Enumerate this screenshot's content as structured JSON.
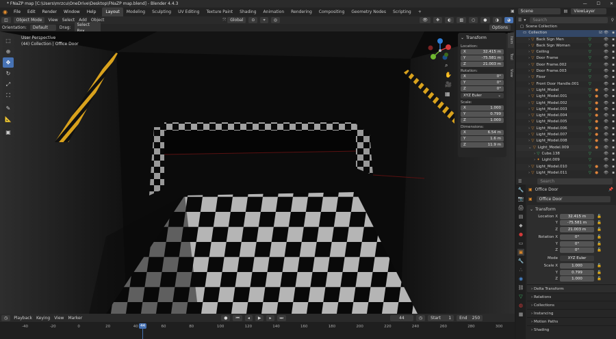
{
  "window": {
    "title": "* FNaZP map [C:\\Users\\mrzcu\\OneDrive\\Desktop\\FNaZP map.blend] - Blender 4.4.3"
  },
  "menu": [
    "File",
    "Edit",
    "Render",
    "Window",
    "Help"
  ],
  "workspaces": [
    "Layout",
    "Modeling",
    "Sculpting",
    "UV Editing",
    "Texture Paint",
    "Shading",
    "Animation",
    "Rendering",
    "Compositing",
    "Geometry Nodes",
    "Scripting"
  ],
  "scene": {
    "name": "Scene",
    "view_layer": "ViewLayer"
  },
  "viewport_header": {
    "mode": "Object Mode",
    "menus": [
      "View",
      "Select",
      "Add",
      "Object"
    ],
    "transform_orientation": "Global",
    "orientation_label": "Orientation:",
    "orientation_value": "Default",
    "drag_label": "Drag:",
    "drag_value": "Select Box",
    "options": "Options"
  },
  "viewport_overlay": {
    "perspective": "User Perspective",
    "collection_info": "(44) Collection | Office Door"
  },
  "gizmo": {
    "x": "X",
    "y": "Y",
    "z": "Z"
  },
  "npanel": {
    "tabs": [
      "Item",
      "Tool",
      "View"
    ],
    "header": "Transform",
    "location_label": "Location:",
    "location": [
      {
        "axis": "X",
        "value": "32.415 m"
      },
      {
        "axis": "Y",
        "value": "-75.581 m"
      },
      {
        "axis": "Z",
        "value": "21.003 m"
      }
    ],
    "rotation_label": "Rotation:",
    "rotation": [
      {
        "axis": "X",
        "value": "0°"
      },
      {
        "axis": "Y",
        "value": "0°"
      },
      {
        "axis": "Z",
        "value": "0°"
      }
    ],
    "rotation_mode": "XYZ Euler",
    "scale_label": "Scale:",
    "scale": [
      {
        "axis": "X",
        "value": "1.000"
      },
      {
        "axis": "Y",
        "value": "0.799"
      },
      {
        "axis": "Z",
        "value": "1.000"
      }
    ],
    "dimensions_label": "Dimensions:",
    "dimensions": [
      {
        "axis": "X",
        "value": "6.54 m"
      },
      {
        "axis": "Y",
        "value": "1.6 m"
      },
      {
        "axis": "Z",
        "value": "11.9 m"
      }
    ]
  },
  "outliner": {
    "search_placeholder": "Search",
    "root": "Scene Collection",
    "collection": "Collection",
    "items": [
      {
        "name": "Back Sign Men"
      },
      {
        "name": "Back Sign Woman"
      },
      {
        "name": "Ceiling"
      },
      {
        "name": "Door Frame"
      },
      {
        "name": "Door Frame.002"
      },
      {
        "name": "Door Frame.003"
      },
      {
        "name": "Floor"
      },
      {
        "name": "Front Door Handle.001"
      },
      {
        "name": "Light_Model"
      },
      {
        "name": "Light_Model.001"
      },
      {
        "name": "Light_Model.002"
      },
      {
        "name": "Light_Model.003"
      },
      {
        "name": "Light_Model.004"
      },
      {
        "name": "Light_Model.005"
      },
      {
        "name": "Light_Model.006"
      },
      {
        "name": "Light_Model.007"
      },
      {
        "name": "Light_Model.008"
      },
      {
        "name": "Light_Model.009"
      },
      {
        "name": "Cube.138"
      },
      {
        "name": "Light.009"
      },
      {
        "name": "Light_Model.010"
      },
      {
        "name": "Light_Model.011"
      }
    ]
  },
  "properties": {
    "search_placeholder": "Search",
    "object_name": "Office Door",
    "object_field": "Office Door",
    "transform_header": "Transform",
    "location": [
      {
        "label": "Location X",
        "value": "32.415 m"
      },
      {
        "label": "Y",
        "value": "-75.581 m"
      },
      {
        "label": "Z",
        "value": "21.003 m"
      }
    ],
    "rotation": [
      {
        "label": "Rotation X",
        "value": "0°"
      },
      {
        "label": "Y",
        "value": "0°"
      },
      {
        "label": "Z",
        "value": "0°"
      }
    ],
    "mode_label": "Mode",
    "mode_value": "XYZ Euler",
    "scale": [
      {
        "label": "Scale X",
        "value": "1.000"
      },
      {
        "label": "Y",
        "value": "0.799"
      },
      {
        "label": "Z",
        "value": "1.000"
      }
    ],
    "delta_transform": "Delta Transform",
    "collapsed_sections": [
      "Relations",
      "Collections",
      "Instancing",
      "Motion Paths",
      "Shading"
    ]
  },
  "timeline": {
    "menus": [
      "Playback",
      "Keying",
      "View",
      "Marker"
    ],
    "current_frame": "44",
    "start_label": "Start",
    "start": "1",
    "end_label": "End",
    "end": "250",
    "ticks": [
      "-40",
      "-20",
      "0",
      "20",
      "40",
      "60",
      "80",
      "100",
      "120",
      "140",
      "160",
      "180",
      "200",
      "220",
      "240",
      "260",
      "280",
      "300"
    ],
    "playhead": "44"
  }
}
